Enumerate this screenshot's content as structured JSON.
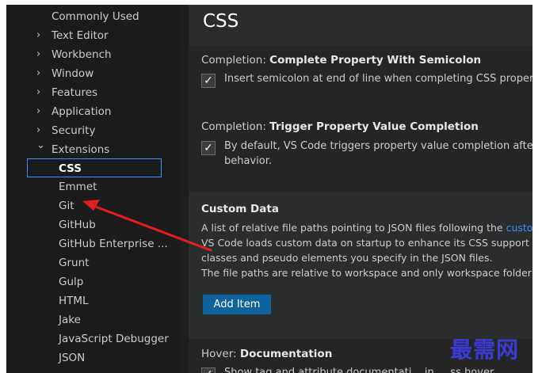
{
  "sidebar": {
    "items": [
      {
        "label": "Commonly Used",
        "chevron": ""
      },
      {
        "label": "Text Editor",
        "chevron": "›"
      },
      {
        "label": "Workbench",
        "chevron": "›"
      },
      {
        "label": "Window",
        "chevron": "›"
      },
      {
        "label": "Features",
        "chevron": "›"
      },
      {
        "label": "Application",
        "chevron": "›"
      },
      {
        "label": "Security",
        "chevron": "›"
      },
      {
        "label": "Extensions",
        "chevron": "⌄"
      }
    ],
    "extensions": [
      {
        "label": "CSS"
      },
      {
        "label": "Emmet"
      },
      {
        "label": "Git"
      },
      {
        "label": "GitHub"
      },
      {
        "label": "GitHub Enterprise ..."
      },
      {
        "label": "Grunt"
      },
      {
        "label": "Gulp"
      },
      {
        "label": "HTML"
      },
      {
        "label": "Jake"
      },
      {
        "label": "JavaScript Debugger"
      },
      {
        "label": "JSON"
      }
    ]
  },
  "content": {
    "title": "CSS",
    "settings": [
      {
        "category": "Completion: ",
        "name": "Complete Property With Semicolon",
        "checked": "✓",
        "description": "Insert semicolon at end of line when completing CSS propertie"
      },
      {
        "category": "Completion: ",
        "name": "Trigger Property Value Completion",
        "checked": "✓",
        "description_line1": "By default, VS Code triggers property value completion after se",
        "description_line2": "behavior."
      },
      {
        "name": "Custom Data",
        "line1_text": "A list of relative file paths pointing to JSON files following the ",
        "line1_link": "custo",
        "line2": "VS Code loads custom data on startup to enhance its CSS support f",
        "line3": "classes and pseudo elements you specify in the JSON files.",
        "line4": "The file paths are relative to workspace and only workspace folder s",
        "button_label": "Add Item"
      },
      {
        "category": "Hover: ",
        "name": "Documentation",
        "checked": "✓",
        "description": "Show tag and attribute documentati... in ... ss hover"
      }
    ]
  },
  "watermark": "最需网",
  "colors": {
    "accent": "#3794ff",
    "button": "#0e639c",
    "annotation_arrow": "#e02020",
    "watermark": "#3b3bd4"
  }
}
